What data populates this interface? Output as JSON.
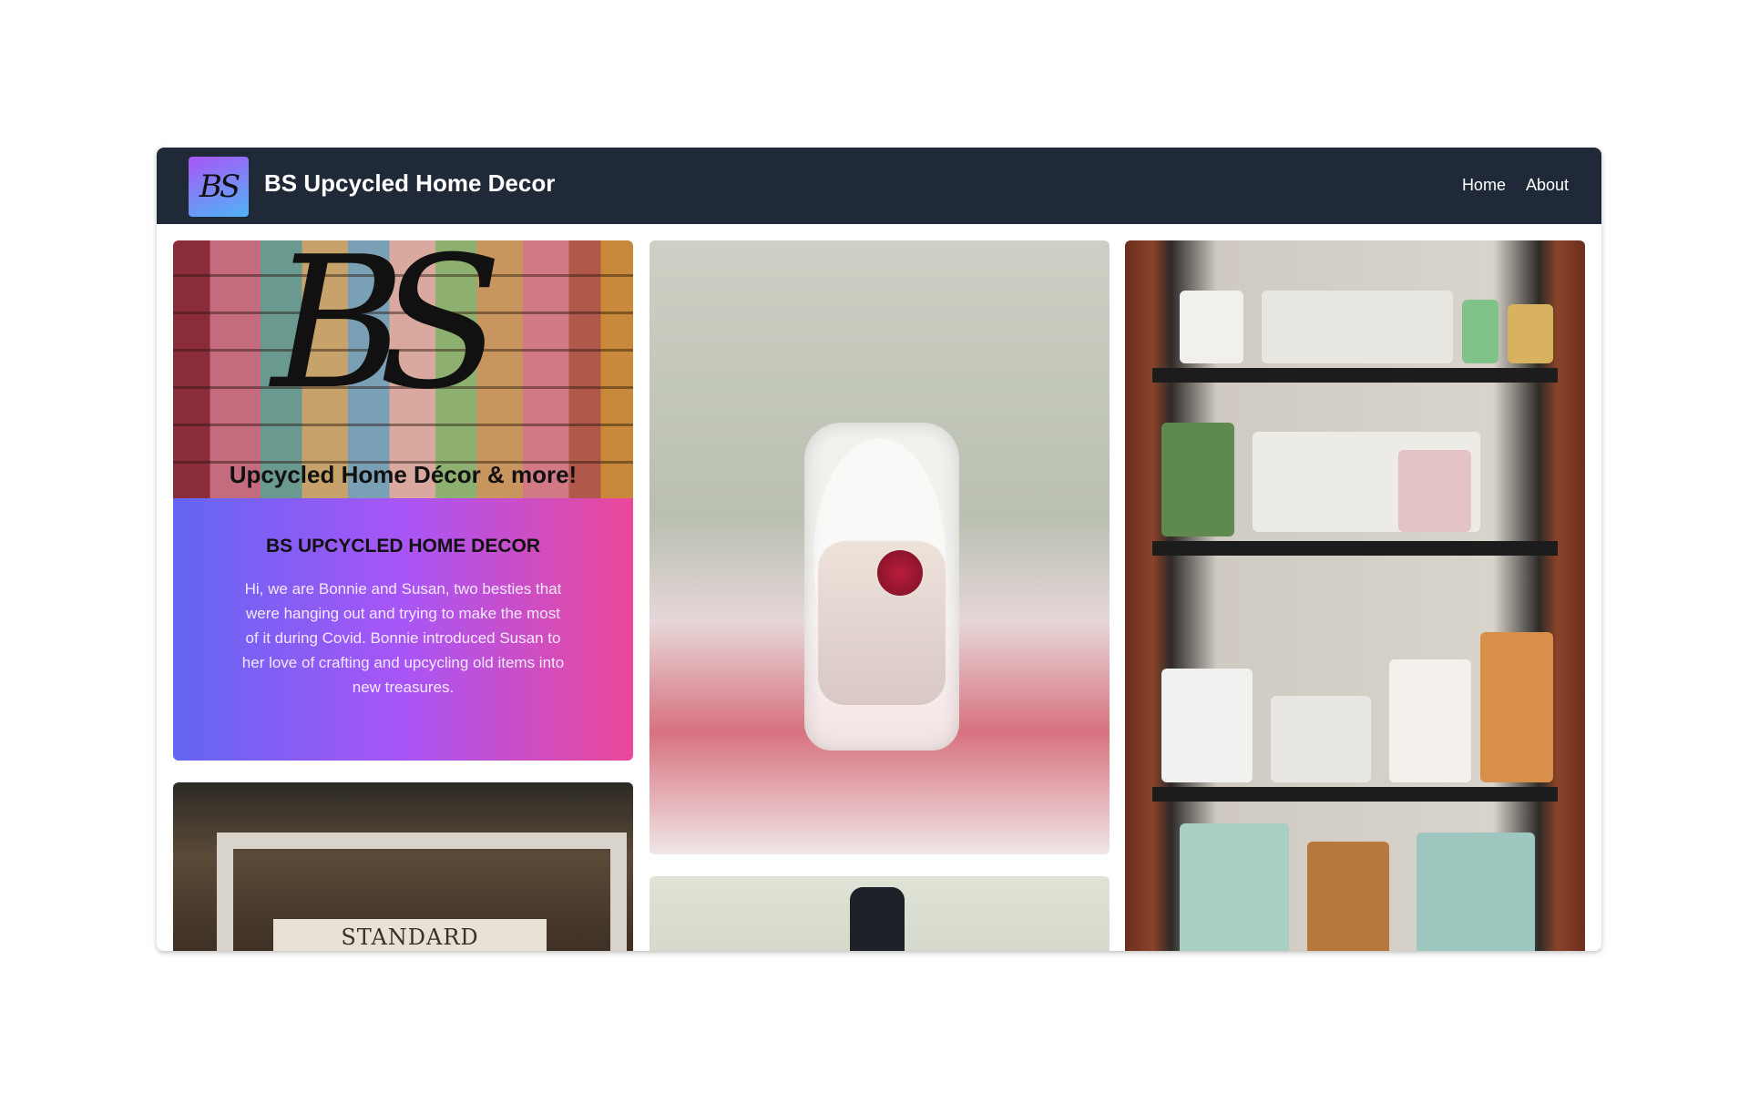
{
  "navbar": {
    "logo_text": "BS",
    "title": "BS Upcycled Home Decor",
    "links": [
      "Home",
      "About"
    ]
  },
  "logo_image": {
    "monogram": "BS",
    "tagline": "Upcycled Home Décor & more!"
  },
  "intro": {
    "title": "BS UPCYCLED HOME DECOR",
    "text": "Hi, we are Bonnie and Susan, two besties that were hanging out and trying to make the most of it during Covid. Bonnie introduced Susan to her love of crafting and upcycling old items into new treasures."
  },
  "photos": {
    "sign_text": "STANDARD PRODUCTS"
  },
  "colors": {
    "navbar_bg": "#1f2937",
    "gradient_start": "#6366f1",
    "gradient_mid": "#a855f7",
    "gradient_end": "#ec4899"
  }
}
